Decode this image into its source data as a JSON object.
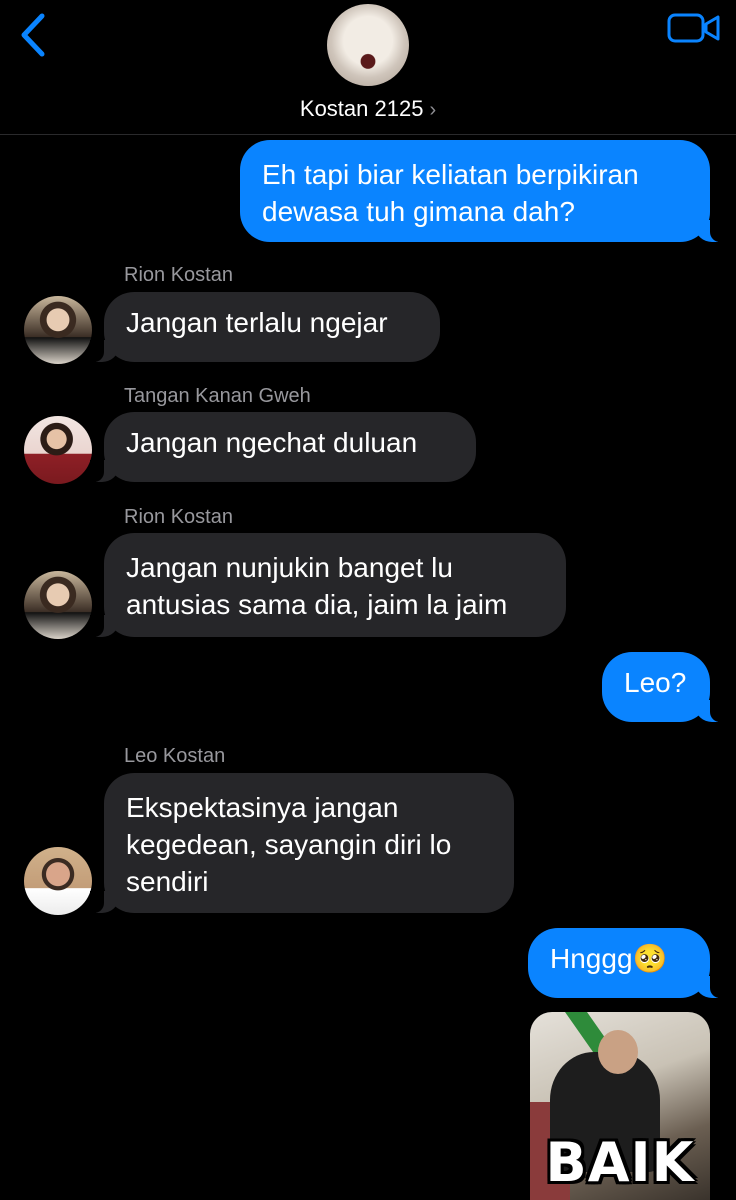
{
  "header": {
    "title": "Kostan 2125",
    "back_icon": "chevron-left-icon",
    "video_icon": "video-camera-icon",
    "accent_color": "#0a84ff"
  },
  "messages": [
    {
      "direction": "outgoing",
      "text_lines": [
        "Eh tapi biar keliatan berpikiran",
        "dewasa tuh gimana dah?"
      ]
    },
    {
      "direction": "incoming",
      "sender": "Rion Kostan",
      "text_lines": [
        "Jangan terlalu ngejar"
      ]
    },
    {
      "direction": "incoming",
      "sender": "Tangan Kanan Gweh",
      "text_lines": [
        "Jangan ngechat duluan"
      ]
    },
    {
      "direction": "incoming",
      "sender": "Rion Kostan",
      "text_lines": [
        "Jangan nunjukin banget lu",
        "antusias sama dia, jaim la jaim"
      ]
    },
    {
      "direction": "outgoing",
      "text_lines": [
        "Leo?"
      ]
    },
    {
      "direction": "incoming",
      "sender": "Leo Kostan",
      "text_lines": [
        "Ekspektasinya jangan",
        "kegedean, sayangin diri lo",
        "sendiri"
      ]
    },
    {
      "direction": "outgoing",
      "text_lines": [
        "Hnggg🥺"
      ]
    },
    {
      "direction": "outgoing",
      "type": "sticker",
      "caption": "BAIK"
    }
  ]
}
